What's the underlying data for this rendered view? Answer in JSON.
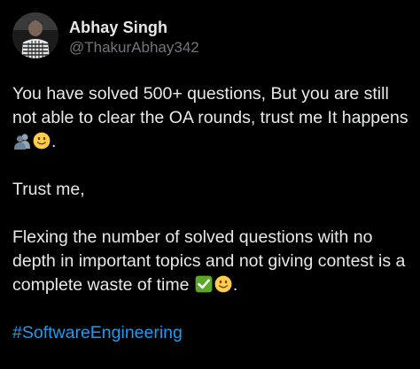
{
  "author": {
    "display_name": "Abhay Singh",
    "handle": "@ThakurAbhay342"
  },
  "tweet": {
    "p1_text": "You have solved 500+ questions, But you are still not able to clear the OA rounds, trust me It happens",
    "p1_end": ".",
    "p2_text": "Trust me,",
    "p3_text": "Flexing the number of solved questions with no depth in important topics and not giving contest is a complete waste of time",
    "p3_end": ".",
    "hashtag": "#SoftwareEngineering"
  },
  "icons": {
    "group": "busts-in-silhouette-emoji",
    "smile": "slightly-smiling-face-emoji",
    "check": "white-check-mark-emoji"
  },
  "colors": {
    "background": "#000000",
    "text": "#e7e9ea",
    "secondary": "#71767b",
    "link": "#1d9bf0",
    "check_green": "#5ca829"
  }
}
